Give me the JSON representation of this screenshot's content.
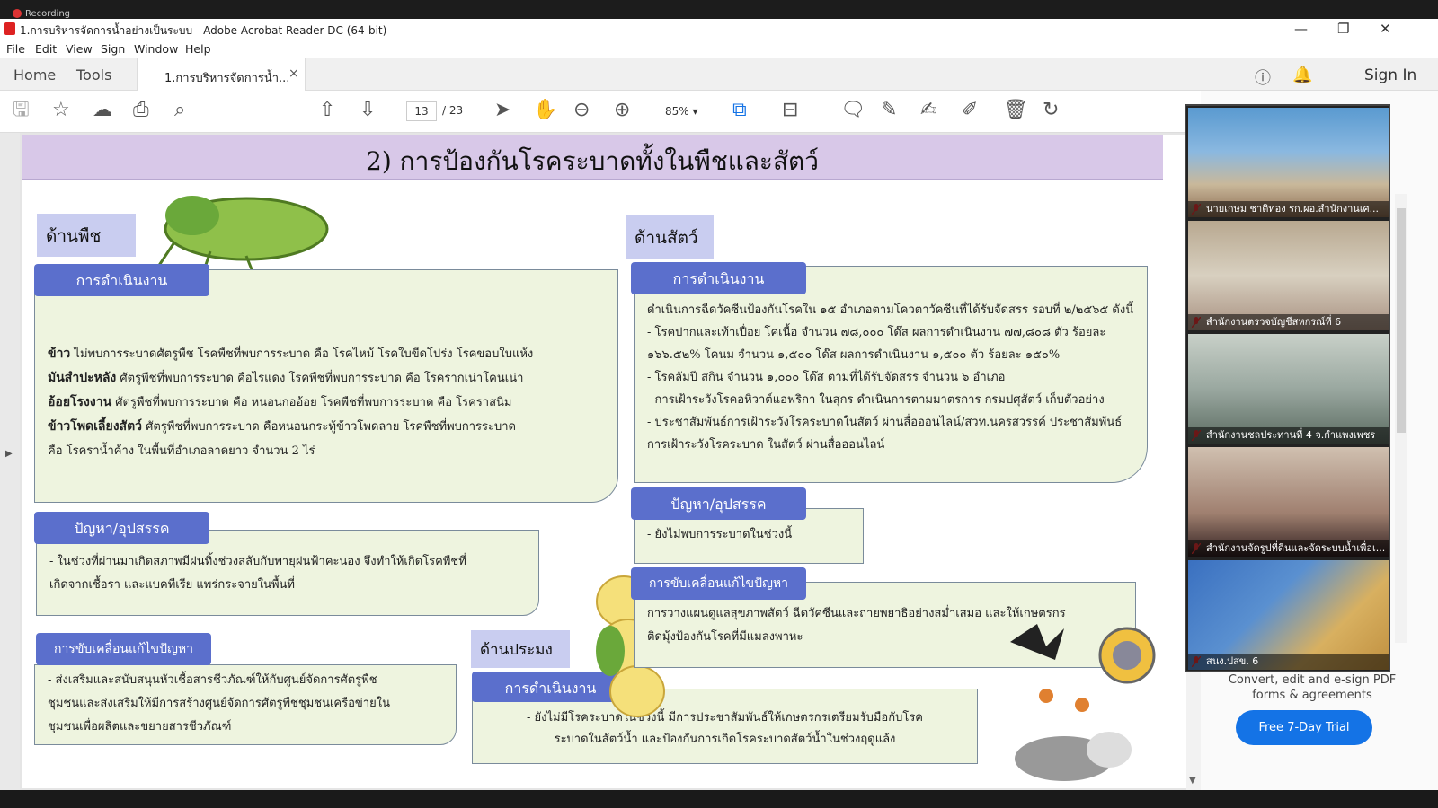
{
  "recording": {
    "label": "Recording"
  },
  "window": {
    "title": "1.การบริหารจัดการน้ำอย่างเป็นระบบ - Adobe Acrobat Reader DC (64-bit)"
  },
  "menu": [
    "File",
    "Edit",
    "View",
    "Sign",
    "Window",
    "Help"
  ],
  "tabs": {
    "home": "Home",
    "tools": "Tools",
    "doc": "1.การบริหารจัดการน้ำ...",
    "close": "×"
  },
  "account": {
    "sign_in": "Sign In"
  },
  "toolbar": {
    "page_current": "13",
    "page_total": "/ 23",
    "zoom": "85%"
  },
  "slide": {
    "title": "2) การป้องกันโรคระบาดทั้งในพืชและสัตว์",
    "plant": {
      "heading": "ด้านพืช",
      "ops_label": "การดำเนินงาน",
      "ops_lines": [
        {
          "bold": "ข้าว",
          "text": " ไม่พบการระบาดศัตรูพืช โรคพืชที่พบการระบาด คือ โรคไหม้ โรคใบขีดโปร่ง โรคขอบใบแห้ง"
        },
        {
          "bold": "มันสำปะหลัง",
          "text": " ศัตรูพืชที่พบการระบาด คือไรแดง โรคพืชที่พบการระบาด คือ โรครากเน่าโคนเน่า"
        },
        {
          "bold": "อ้อยโรงงาน",
          "text": " ศัตรูพืชที่พบการระบาด คือ หนอนกออ้อย โรคพืชที่พบการระบาด คือ โรคราสนิม"
        },
        {
          "bold": "ข้าวโพดเลี้ยงสัตว์",
          "text": " ศัตรูพืชที่พบการระบาด คือหนอนกระทู้ข้าวโพดลาย โรคพืชที่พบการระบาด"
        },
        {
          "bold": "",
          "text": "คือ โรคราน้ำค้าง ในพื้นที่อำเภอลาดยาว จำนวน 2 ไร่"
        }
      ],
      "problem_label": "ปัญหา/อุปสรรค",
      "problem_lines": [
        "- ในช่วงที่ผ่านมาเกิดสภาพมีฝนทิ้งช่วงสลับกับพายุฝนฟ้าคะนอง จึงทำให้เกิดโรคพืชที่",
        "เกิดจากเชื้อรา และแบคทีเรีย แพร่กระจายในพื้นที่"
      ],
      "drive_label": "การขับเคลื่อนแก้ไขปัญหา",
      "drive_lines": [
        "- ส่งเสริมและสนับสนุนหัวเชื้อสารชีวภัณฑ์ให้กับศูนย์จัดการศัตรูพืช",
        "ชุมชนและส่งเสริมให้มีการสร้างศูนย์จัดการศัตรูพืชชุมชนเครือข่ายใน",
        "ชุมชนเพื่อผลิตและขยายสารชีวภัณฑ์"
      ]
    },
    "fishery": {
      "heading": "ด้านประมง",
      "ops_label": "การดำเนินงาน",
      "ops_lines": [
        "- ยังไม่มีโรคระบาดในช่วงนี้ มีการประชาสัมพันธ์ให้เกษตรกรเตรียมรับมือกับโรค",
        "ระบาดในสัตว์น้ำ และป้องกันการเกิดโรคระบาดสัตว์น้ำในช่วงฤดูแล้ง"
      ]
    },
    "animal": {
      "heading": "ด้านสัตว์",
      "ops_label": "การดำเนินงาน",
      "ops_lines": [
        "ดำเนินการฉีดวัคซีนป้องกันโรคใน ๑๕ อำเภอตามโควตาวัคซีนที่ได้รับจัดสรร รอบที่ ๒/๒๕๖๕ ดังนี้",
        "- โรคปากและเท้าเปื่อย โคเนื้อ จำนวน ๗๘,๐๐๐ โด๊ส ผลการดำเนินงาน ๗๗,๘๐๘ ตัว ร้อยละ",
        "๑๖๖.๕๒% โคนม จำนวน ๑,๕๐๐ โด๊ส ผลการดำเนินงาน ๑,๕๐๐ ตัว ร้อยละ ๑๕๐%",
        "- โรคลัมปี สกิน จำนวน ๑,๐๐๐ โด๊ส ตามที่ได้รับจัดสรร จำนวน ๖ อำเภอ",
        "- การเฝ้าระวังโรคอหิวาต์แอฟริกา ในสุกร ดำเนินการตามมาตรการ กรมปศุสัตว์ เก็บตัวอย่าง",
        "- ประชาสัมพันธ์การเฝ้าระวังโรคระบาดในสัตว์ ผ่านสื่อออนไลน์/สวท.นครสวรรค์ ประชาสัมพันธ์",
        "การเฝ้าระวังโรคระบาด ในสัตว์ ผ่านสื่อออนไลน์"
      ],
      "problem_label": "ปัญหา/อุปสรรค",
      "problem_lines": [
        "- ยังไม่พบการระบาดในช่วงนี้"
      ],
      "drive_label": "การขับเคลื่อนแก้ไขปัญหา",
      "drive_lines": [
        "การวางแผนดูแลสุขภาพสัตว์ ฉีดวัคซีนและถ่ายพยาธิอย่างสม่ำเสมอ และให้เกษตรกร",
        "ติดมุ้งป้องกันโรคที่มีแมลงพาหะ"
      ]
    }
  },
  "participants": [
    "นายเกษม ชาติทอง รก.ผอ.สำนักงานเศ...",
    "สำนักงานตรวจบัญชีสหกรณ์ที่ 6",
    "สำนักงานชลประทานที่ 4 จ.กำแพงเพชร",
    "สำนักงานจัดรูปที่ดินและจัดระบบน้ำเพื่อเ...",
    "สนง.ปสข. 6"
  ],
  "promo": {
    "text": "Convert, edit and e-sign PDF forms & agreements",
    "button": "Free 7-Day Trial"
  },
  "colors": {
    "accent": "#1473e6",
    "pill": "#5b6fcc",
    "section": "#c9cdf0",
    "box": "#eef4df",
    "header": "#d8c8e8"
  }
}
